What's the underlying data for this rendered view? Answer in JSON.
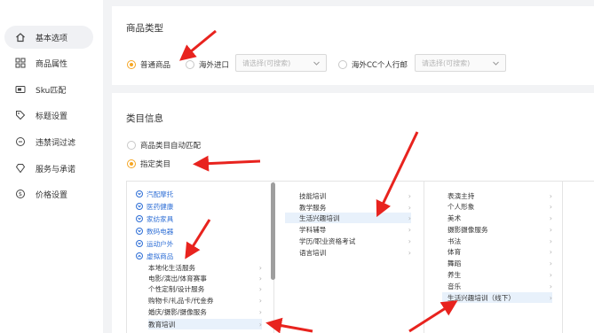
{
  "sidebar": {
    "items": [
      {
        "label": "基本选项",
        "icon": "house-icon",
        "active": true
      },
      {
        "label": "商品属性",
        "icon": "grid-icon"
      },
      {
        "label": "Sku匹配",
        "icon": "card-icon"
      },
      {
        "label": "标题设置",
        "icon": "tag-icon"
      },
      {
        "label": "违禁词过滤",
        "icon": "circle-icon"
      },
      {
        "label": "服务与承诺",
        "icon": "diamond-icon"
      },
      {
        "label": "价格设置",
        "icon": "dollar-icon"
      }
    ]
  },
  "product_type": {
    "title": "商品类型",
    "options": [
      {
        "label": "普通商品",
        "selected": true
      },
      {
        "label": "海外进口"
      },
      {
        "label": "海外CC个人行邮"
      }
    ],
    "select_placeholder": "请选择(可搜索)"
  },
  "category": {
    "title": "类目信息",
    "radios": [
      {
        "label": "商品类目自动匹配"
      },
      {
        "label": "指定类目",
        "selected": true
      }
    ],
    "col1_top": [
      "汽配摩托",
      "医药健康",
      "家纺家具",
      "数码电器",
      "运动户外",
      "虚拟商品"
    ],
    "col1_sub": [
      "本地化生活服务",
      "电影/演出/体育赛事",
      "个性定制/设计服务",
      "购物卡/礼品卡/代金券",
      "婚庆/摄影/摄像服务",
      "教育培训"
    ],
    "col2": [
      "技能培训",
      "教学服务",
      "生活兴趣培训",
      "学科辅导",
      "学历/职业资格考试",
      "语言培训"
    ],
    "col3": [
      "表演主持",
      "个人形象",
      "美术",
      "摄影摄像服务",
      "书法",
      "体育",
      "舞蹈",
      "养生",
      "音乐",
      "生活兴趣培训（线下）"
    ]
  },
  "colors": {
    "accent": "#f5a623",
    "link": "#2f6fd6",
    "annotation": "#e8231e"
  }
}
